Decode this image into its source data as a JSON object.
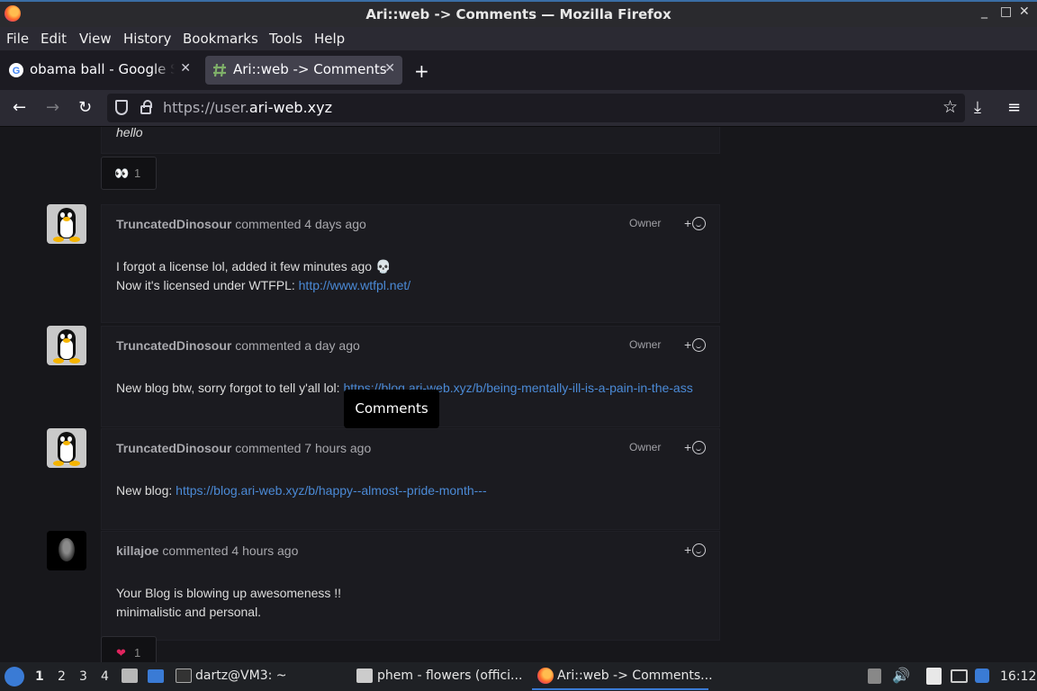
{
  "window": {
    "title": "Ari::web -> Comments — Mozilla Firefox",
    "controls": [
      "_",
      "□",
      "✕"
    ]
  },
  "menu": [
    "File",
    "Edit",
    "View",
    "History",
    "Bookmarks",
    "Tools",
    "Help"
  ],
  "tabs": [
    {
      "label": "obama ball - Google Se",
      "close": "✕"
    },
    {
      "label": "Ari::web -> Comments",
      "close": "✕"
    }
  ],
  "new_tab": "+",
  "nav": {
    "url_prefix": "https://user.",
    "url_domain": "ari-web.xyz",
    "back": "←",
    "forward": "→",
    "reload": "↻",
    "star": "☆",
    "download": "⤓",
    "menu": "≡"
  },
  "page": {
    "top_comment_text": "hello",
    "top_reaction": {
      "emoji": "👀",
      "count": "1"
    },
    "comments": [
      {
        "author": "TruncatedDinosour",
        "action": "commented",
        "time": "4 days ago",
        "badge": "Owner",
        "line1": "I forgot a license lol, added it few minutes ago 💀",
        "line2_prefix": "Now it's licensed under WTFPL: ",
        "line2_link": "http://www.wtfpl.net/"
      },
      {
        "author": "TruncatedDinosour",
        "action": "commented",
        "time": "a day ago",
        "badge": "Owner",
        "line1_prefix": "New blog btw, sorry forgot to tell y'all lol: ",
        "line1_link": "https://blog.ari-web.xyz/b/being-mentally-ill-is-a-pain-in-the-ass"
      },
      {
        "author": "TruncatedDinosour",
        "action": "commented",
        "time": "7 hours ago",
        "badge": "Owner",
        "line1_prefix": "New blog: ",
        "line1_link": "https://blog.ari-web.xyz/b/happy--almost--pride-month---"
      },
      {
        "author": "killajoe",
        "action": "commented",
        "time": "4 hours ago",
        "line1": "Your Blog is blowing up awesomeness !!",
        "line2": "minimalistic and personal."
      }
    ],
    "bottom_reaction": {
      "emoji": "❤",
      "count": "1"
    },
    "react_add": "+",
    "tooltip": "Comments"
  },
  "taskbar": {
    "workspaces": [
      "1",
      "2",
      "3",
      "4"
    ],
    "tasks": [
      "dartz@VM3: ~",
      "phem - flowers (offici...",
      "Ari::web -> Comments..."
    ],
    "clock": "16:12"
  },
  "colors": {
    "link": "#4b8ad6",
    "accent": "#3a7bd5",
    "background": "#17171b"
  }
}
